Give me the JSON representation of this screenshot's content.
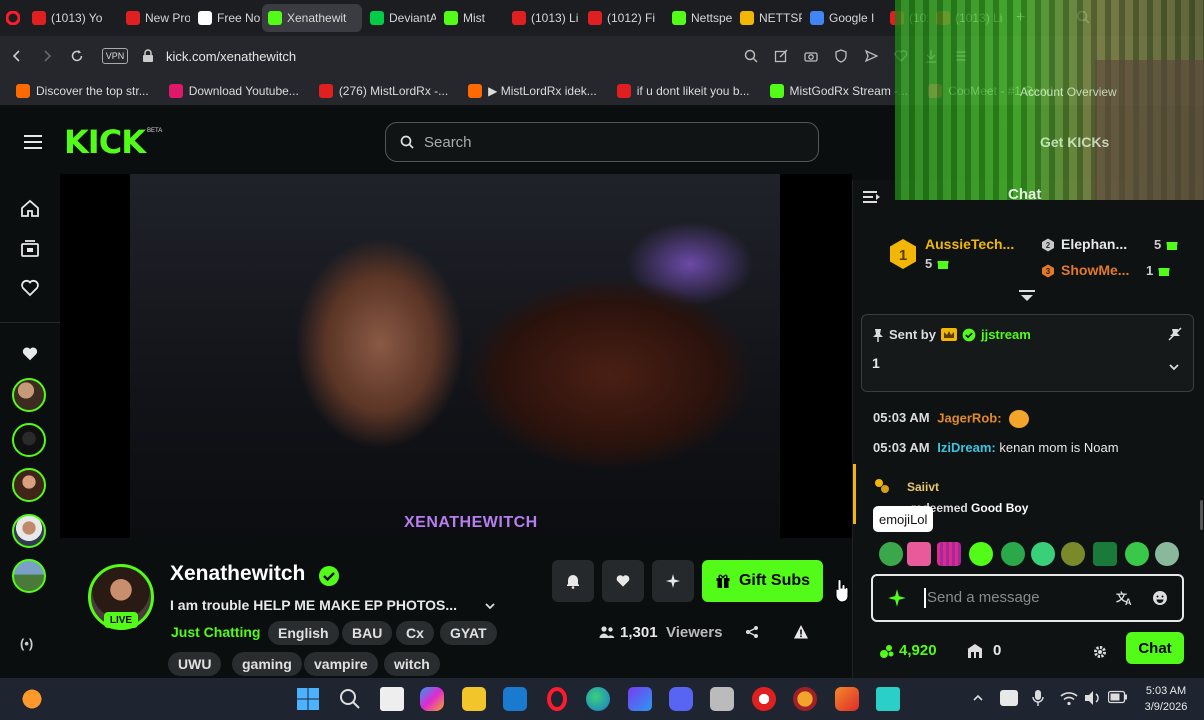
{
  "browser": {
    "tabs": [
      {
        "title": "(1013) Yo",
        "color": "#e02020"
      },
      {
        "title": "New Pro",
        "color": "#e02020"
      },
      {
        "title": "Free No",
        "color": "#ffffff"
      },
      {
        "title": "Xenathewit",
        "color": "#53fc18"
      },
      {
        "title": "DeviantA",
        "color": "#05cc47"
      },
      {
        "title": "Mist",
        "color": "#53fc18"
      },
      {
        "title": "(1013) Li",
        "color": "#e02020"
      },
      {
        "title": "(1012) Fi",
        "color": "#e02020"
      },
      {
        "title": "Nettsper",
        "color": "#53fc18"
      },
      {
        "title": "NETTSPE",
        "color": "#f2b705"
      },
      {
        "title": "Google I",
        "color": "#4285f4"
      },
      {
        "title": "(101",
        "color": "#e02020"
      },
      {
        "title": "(1013) Li",
        "color": "#e02020"
      }
    ],
    "vpn_label": "VPN",
    "url": "kick.com/xenathewitch",
    "bookmarks": [
      {
        "label": "Discover the top str...",
        "color": "#ff6a00"
      },
      {
        "label": "Download Youtube...",
        "color": "#e0186b"
      },
      {
        "label": "(276) MistLordRx -...",
        "color": "#e02020"
      },
      {
        "label": "▶ MistLordRx idek...",
        "color": "#ff6a00"
      },
      {
        "label": "if u dont likeit you b...",
        "color": "#e02020"
      },
      {
        "label": "MistGodRx Stream -...",
        "color": "#53fc18"
      },
      {
        "label": "CooMeet - #1 Rand...",
        "color": "#ff3c6e"
      },
      {
        "label": "Account Overview",
        "color": "#888888"
      }
    ]
  },
  "site": {
    "logo": "KICK",
    "logo_badge": "BETA",
    "search_placeholder": "Search",
    "watermark": "XENATHEWITCH",
    "streamer": {
      "name": "Xenathewitch",
      "live_badge": "LIVE",
      "title": "I am  trouble HELP ME MAKE EP PHOTOS...",
      "category": "Just Chatting",
      "tags": [
        "English",
        "BAU",
        "Cx",
        "GYAT",
        "UWU",
        "gaming",
        "vampire",
        "witch"
      ],
      "viewers": "1,301",
      "viewers_label": "Viewers"
    },
    "gift_subs_label": "Gift Subs"
  },
  "chat": {
    "header": "Chat",
    "get_kicks": "Get KICKs",
    "leaderboard": [
      {
        "rank": "1",
        "name": "AussieTech...",
        "subs": "5"
      },
      {
        "rank": "2",
        "name": "Elephan...",
        "subs": "5"
      },
      {
        "rank": "3",
        "name": "ShowMe...",
        "subs": "1"
      }
    ],
    "pinned": {
      "sent_by": "Sent by",
      "user": "jjstream",
      "message": "1"
    },
    "messages": [
      {
        "time": "05:03 AM",
        "user": "JagerRob:",
        "text": "",
        "color": "#e08a2a"
      },
      {
        "time": "05:03 AM",
        "user": "IziDream:",
        "text": "kenan mom is Noam",
        "color": "#3ac4e0"
      }
    ],
    "redeem": {
      "user": "Saiivt",
      "text_pre": "redeemed",
      "reward": "Good Boy"
    },
    "tooltip": "emojiLol",
    "input_placeholder": "Send a message",
    "kicks_balance": "4,920",
    "subs_count": "0",
    "chat_button": "Chat"
  },
  "taskbar": {
    "time": "5:03 AM",
    "date": "3/9/2026"
  }
}
